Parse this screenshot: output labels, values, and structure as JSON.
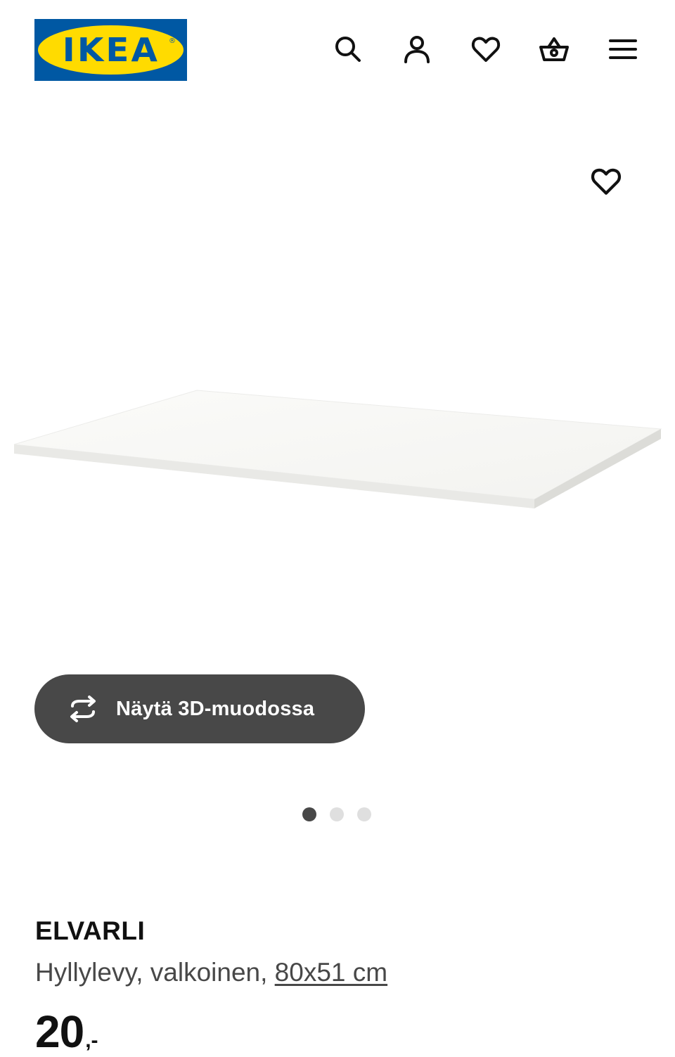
{
  "header": {
    "logo_text": "IKEA",
    "logo_reg": "®",
    "icons": [
      "search-icon",
      "account-icon",
      "heart-icon",
      "basket-icon",
      "menu-icon"
    ]
  },
  "gallery": {
    "favorite_icon": "heart-icon",
    "view_3d_label": "Näytä 3D-muodossa",
    "view_3d_icon": "rotate-icon",
    "dots_total": 3,
    "active_dot": 1
  },
  "product": {
    "name": "ELVARLI",
    "description_prefix": "Hyllylevy, valkoinen, ",
    "size": "80x51 cm",
    "price_integer": "20",
    "price_suffix": ",-"
  },
  "colors": {
    "brand_blue": "#0058a3",
    "brand_yellow": "#ffdb00",
    "button_dark": "#484848",
    "text_primary": "#111111",
    "text_secondary": "#484848"
  }
}
